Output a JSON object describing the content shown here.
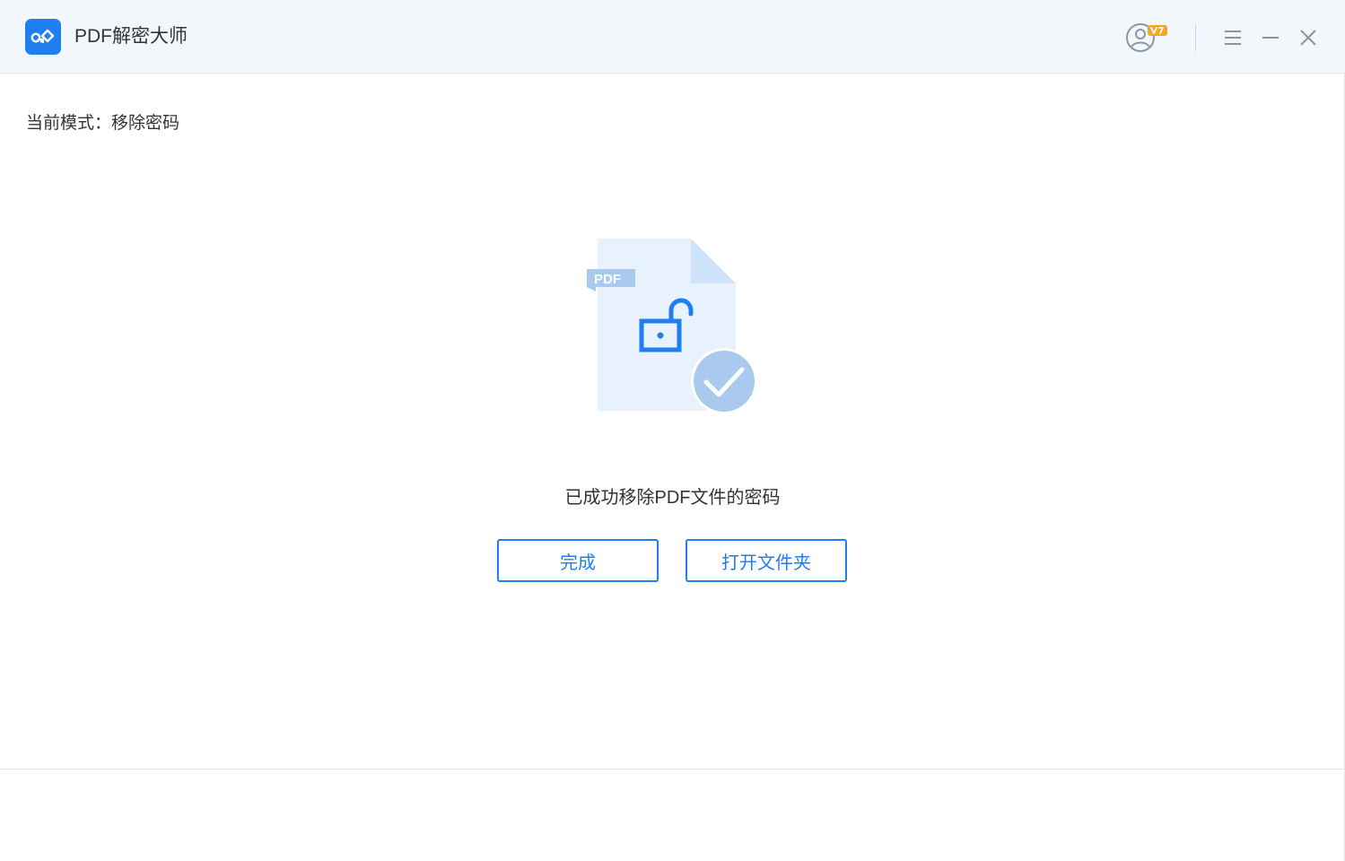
{
  "window": {
    "title": "PDF解密大师",
    "controls": {
      "account": "user-account-icon",
      "menu": "menu-icon",
      "minimize": "minimize-icon",
      "close": "close-icon"
    }
  },
  "mode": {
    "label": "当前模式：移除密码"
  },
  "illustration": {
    "badge_text": "PDF",
    "icons": [
      "pdf-file-icon",
      "unlock-icon",
      "check-icon"
    ]
  },
  "result": {
    "message": "已成功移除PDF文件的密码"
  },
  "buttons": {
    "done": "完成",
    "open_folder": "打开文件夹"
  },
  "colors": {
    "accent": "#1f7ff0",
    "titlebar_bg": "#f2f7fc",
    "file_bg": "#e8f2fd",
    "check_bg": "#a9c9ee",
    "vip_badge": "#f5a623"
  }
}
